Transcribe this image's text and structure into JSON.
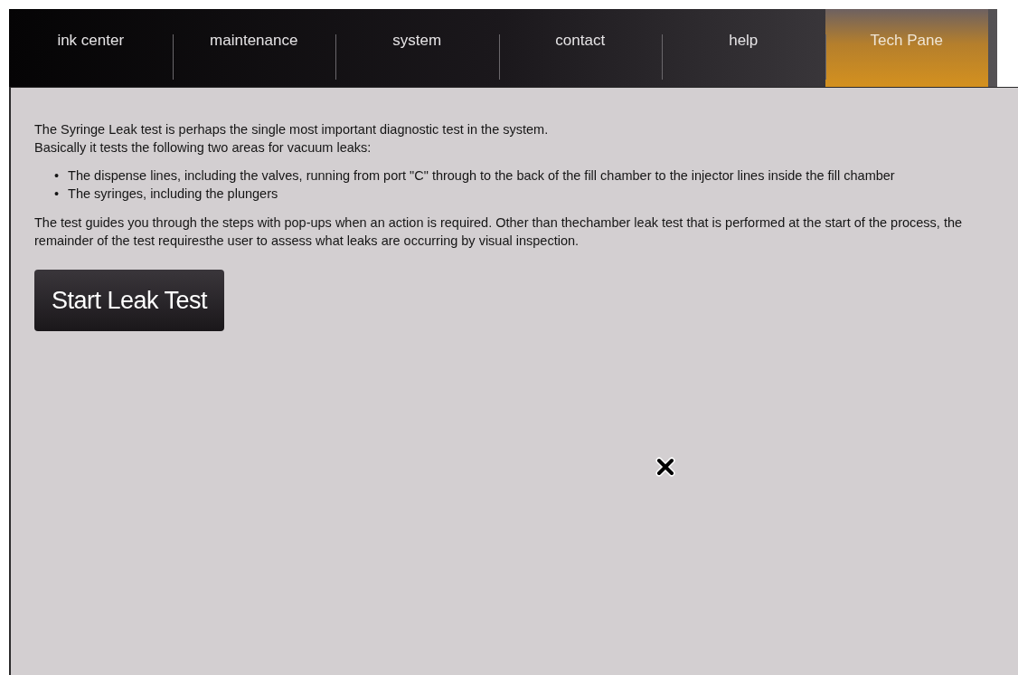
{
  "tabs": [
    {
      "label": "ink center",
      "selected": false
    },
    {
      "label": "maintenance",
      "selected": false
    },
    {
      "label": "system",
      "selected": false
    },
    {
      "label": "contact",
      "selected": false
    },
    {
      "label": "help",
      "selected": false
    },
    {
      "label": "Tech Pane",
      "selected": true
    }
  ],
  "intro": [
    "The Syringe Leak test is perhaps the single most important diagnostic test in the system.",
    "Basically it tests the following two areas for vacuum leaks:"
  ],
  "areas": [
    {
      "bullet": "•",
      "text": "The dispense lines, including the valves, running from port \"C\" through to the back of the fill chamber to the injector lines inside the fill chamber"
    },
    {
      "bullet": "•",
      "text": "The syringes, including the plungers"
    }
  ],
  "note": "The test guides you through the steps with pop-ups when an action is required. Other than thechamber leak test that is performed at the start of the process, the remainder of the test requiresthe user to assess what leaks are occurring by visual inspection.",
  "button": "Start Leak Test"
}
